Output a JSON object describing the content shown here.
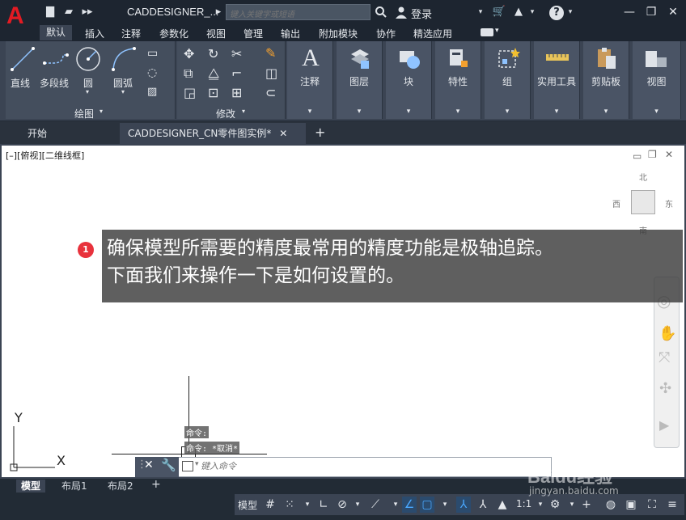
{
  "title_bar": {
    "app_title": "CADDESIGNER_...",
    "search_placeholder": "键入关键字或短语",
    "login_label": "登录"
  },
  "menu": {
    "items": [
      "默认",
      "插入",
      "注释",
      "参数化",
      "视图",
      "管理",
      "输出",
      "附加模块",
      "协作",
      "精选应用"
    ]
  },
  "ribbon": {
    "draw_tools": [
      "直线",
      "多段线",
      "圆",
      "圆弧"
    ],
    "draw_group": "绘图",
    "modify_group": "修改",
    "big_buttons": [
      "注释",
      "图层",
      "块",
      "特性",
      "组",
      "实用工具",
      "剪贴板",
      "视图"
    ]
  },
  "doc_tabs": {
    "start": "开始",
    "current": "CADDESIGNER_CN零件图实例*"
  },
  "viewport": {
    "label": "[–][俯视][二维线框]",
    "compass": {
      "north": "北",
      "west": "西",
      "east": "东",
      "south": "南"
    },
    "axis_y": "Y",
    "axis_x": "X"
  },
  "tooltip": {
    "number": "1",
    "line1": "确保模型所需要的精度最常用的精度功能是极轴追踪。",
    "line2": "下面我们来操作一下是如何设置的。"
  },
  "command": {
    "history1": "命令:",
    "history2": "命令: *取消*",
    "placeholder": "键入命令"
  },
  "layout_tabs": [
    "模型",
    "布局1",
    "布局2"
  ],
  "status_bar": {
    "model_label": "模型",
    "scale": "1:1"
  },
  "watermark": {
    "brand": "Baidu经验",
    "url": "jingyan.baidu.com"
  },
  "colors": {
    "accent_red": "#e31b23",
    "ribbon_bg": "#3b4453",
    "active_blue": "#4aa8ff"
  }
}
